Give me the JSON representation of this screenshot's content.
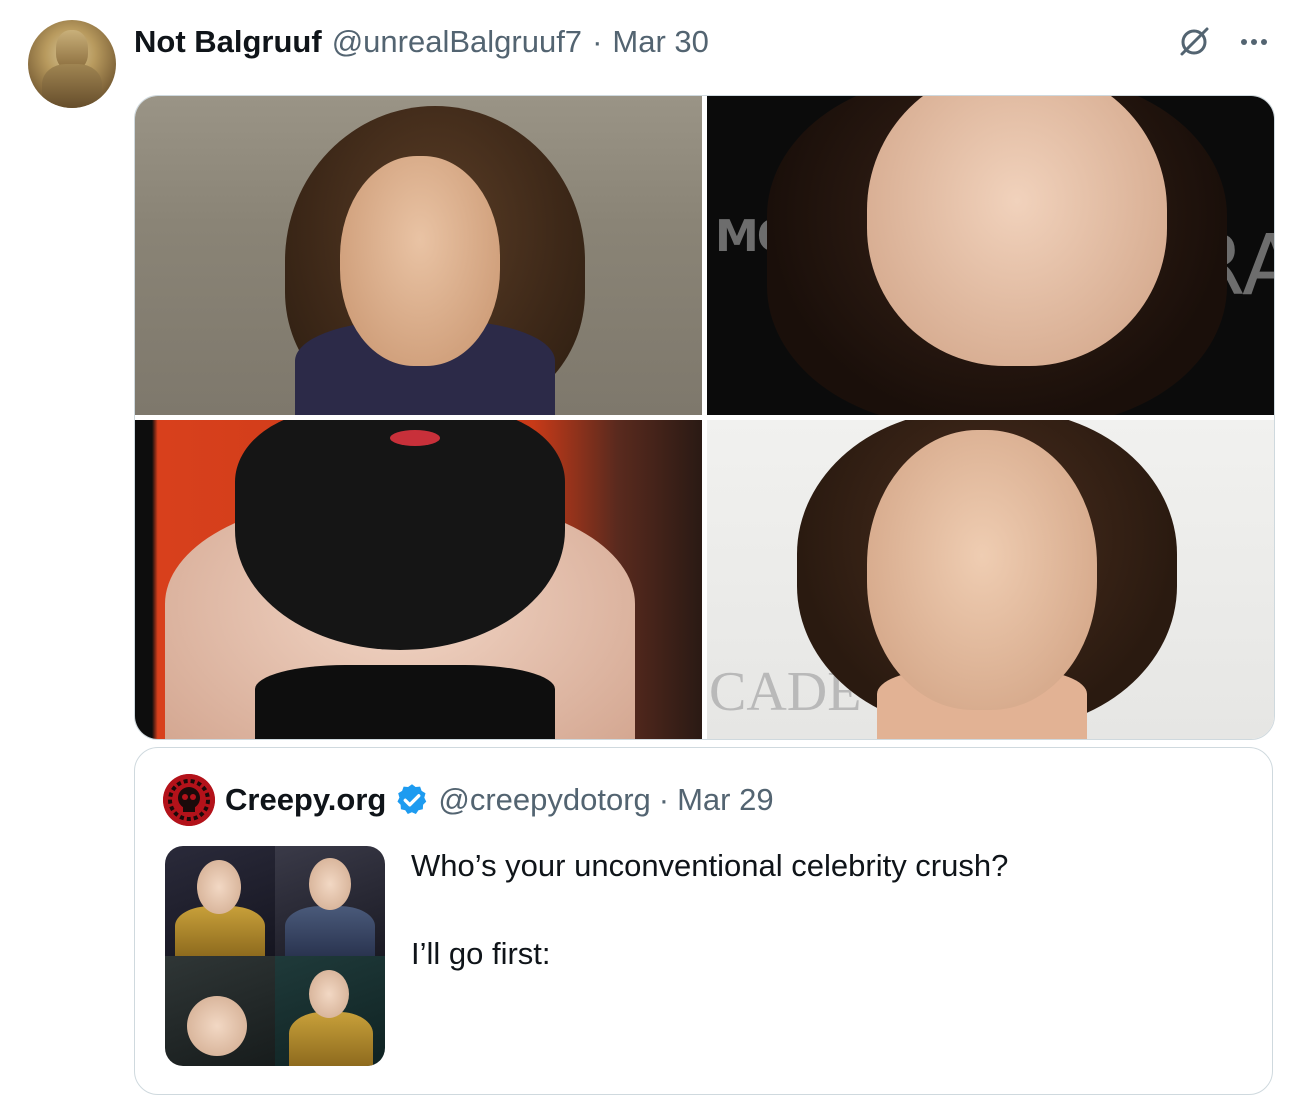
{
  "tweet": {
    "display_name": "Not Balgruuf",
    "handle": "@unrealBalgruuf7",
    "separator": "·",
    "date": "Mar 30",
    "icons": {
      "grok": "grok-icon",
      "more": "more-icon"
    },
    "media": [
      {
        "name": "photo-1"
      },
      {
        "name": "photo-2",
        "sign_text": "MON BLAN",
        "sign_text_right": "RA"
      },
      {
        "name": "photo-3"
      },
      {
        "name": "photo-4",
        "sign_text": "CADE"
      }
    ]
  },
  "quoted_tweet": {
    "display_name": "Creepy.org",
    "verified": true,
    "handle": "@creepydotorg",
    "separator": "·",
    "date": "Mar 29",
    "text_line_1": "Who’s your unconventional celebrity crush?",
    "text_line_2": "I’ll go first:"
  },
  "colors": {
    "text_primary": "#0f1419",
    "text_secondary": "#536471",
    "border": "#cfd9de",
    "verified_blue": "#1d9bf0"
  }
}
